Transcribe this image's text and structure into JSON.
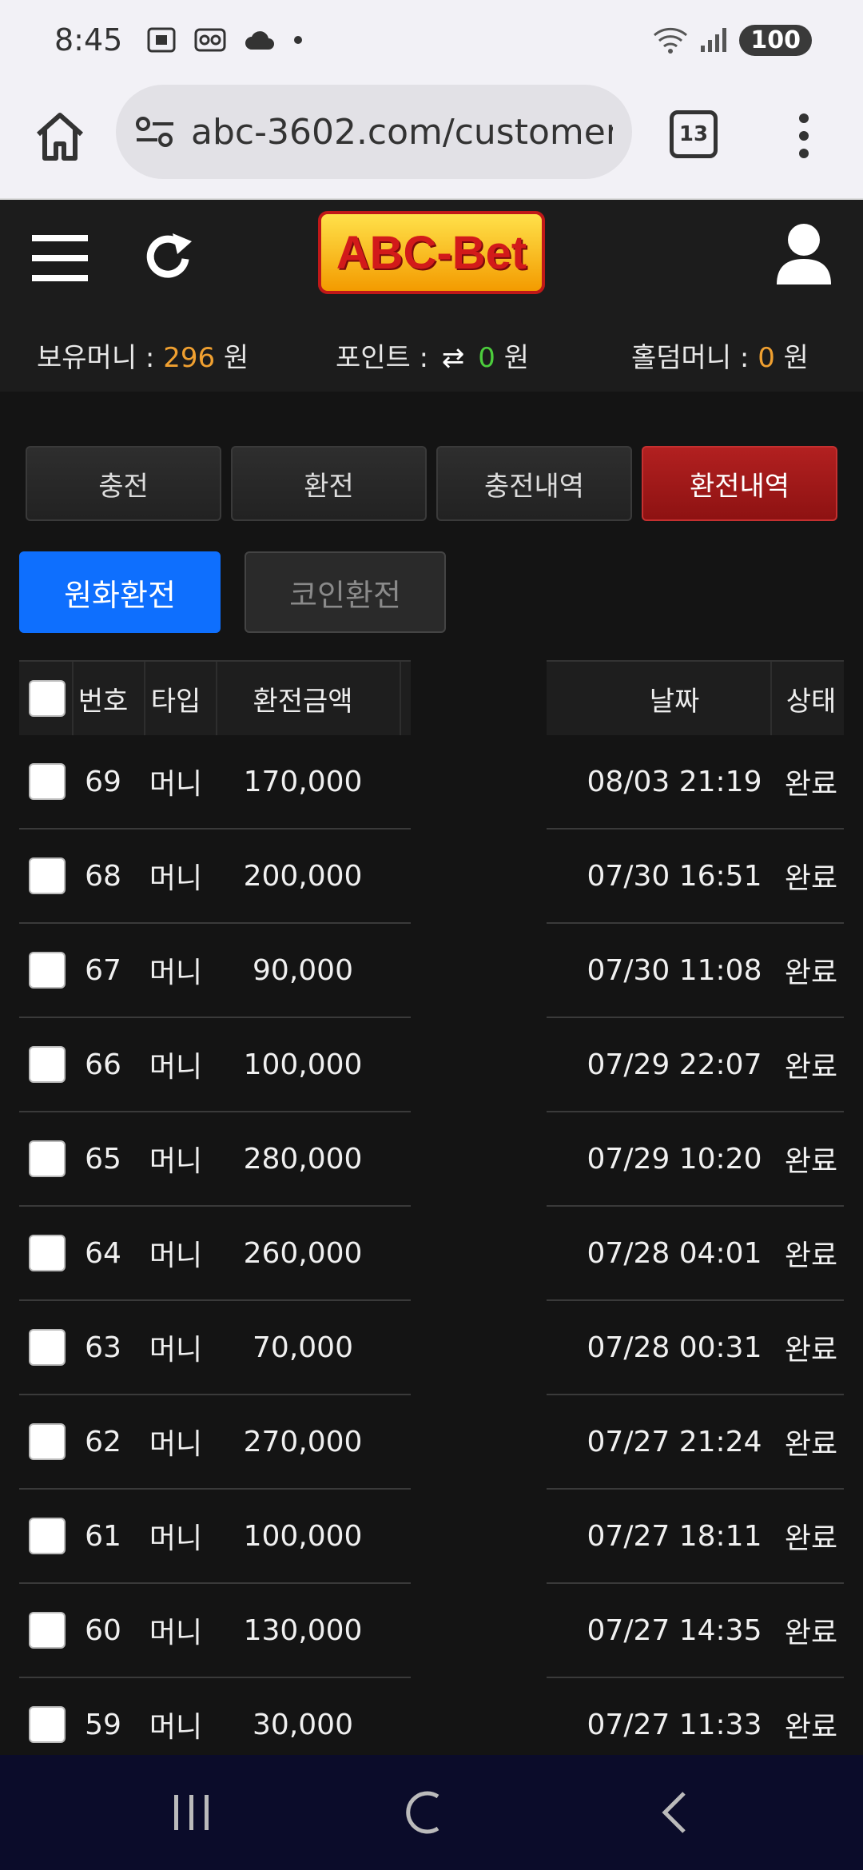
{
  "status_bar": {
    "time": "8:45",
    "battery": "100"
  },
  "browser": {
    "url": "abc-3602.com/customer",
    "tab_count": "13"
  },
  "header": {
    "logo_text": "ABC-Bet",
    "balances": {
      "money_label": "보유머니 :",
      "money_value": "296",
      "money_unit": "원",
      "point_label": "포인트 :",
      "point_value": "0",
      "point_unit": "원",
      "holdem_label": "홀덤머니 :",
      "holdem_value": "0",
      "holdem_unit": "원"
    }
  },
  "tabs": [
    "충전",
    "환전",
    "충전내역",
    "환전내역"
  ],
  "active_tab": "환전내역",
  "subtabs": {
    "won": "원화환전",
    "coin": "코인환전"
  },
  "table": {
    "headers": {
      "no": "번호",
      "type": "타입",
      "amount": "환전금액",
      "date": "날짜",
      "status": "상태"
    },
    "rows": [
      {
        "no": "69",
        "type": "머니",
        "amount": "170,000",
        "date": "08/03 21:19",
        "status": "완료"
      },
      {
        "no": "68",
        "type": "머니",
        "amount": "200,000",
        "date": "07/30 16:51",
        "status": "완료"
      },
      {
        "no": "67",
        "type": "머니",
        "amount": "90,000",
        "date": "07/30 11:08",
        "status": "완료"
      },
      {
        "no": "66",
        "type": "머니",
        "amount": "100,000",
        "date": "07/29 22:07",
        "status": "완료"
      },
      {
        "no": "65",
        "type": "머니",
        "amount": "280,000",
        "date": "07/29 10:20",
        "status": "완료"
      },
      {
        "no": "64",
        "type": "머니",
        "amount": "260,000",
        "date": "07/28 04:01",
        "status": "완료"
      },
      {
        "no": "63",
        "type": "머니",
        "amount": "70,000",
        "date": "07/28 00:31",
        "status": "완료"
      },
      {
        "no": "62",
        "type": "머니",
        "amount": "270,000",
        "date": "07/27 21:24",
        "status": "완료"
      },
      {
        "no": "61",
        "type": "머니",
        "amount": "100,000",
        "date": "07/27 18:11",
        "status": "완료"
      },
      {
        "no": "60",
        "type": "머니",
        "amount": "130,000",
        "date": "07/27 14:35",
        "status": "완료"
      },
      {
        "no": "59",
        "type": "머니",
        "amount": "30,000",
        "date": "07/27 11:33",
        "status": "완료"
      }
    ]
  },
  "colors": {
    "active_tab": "#a81818",
    "active_subtab": "#0e6ffe",
    "accent_orange": "#f0a030",
    "accent_green": "#4ccd3c"
  }
}
